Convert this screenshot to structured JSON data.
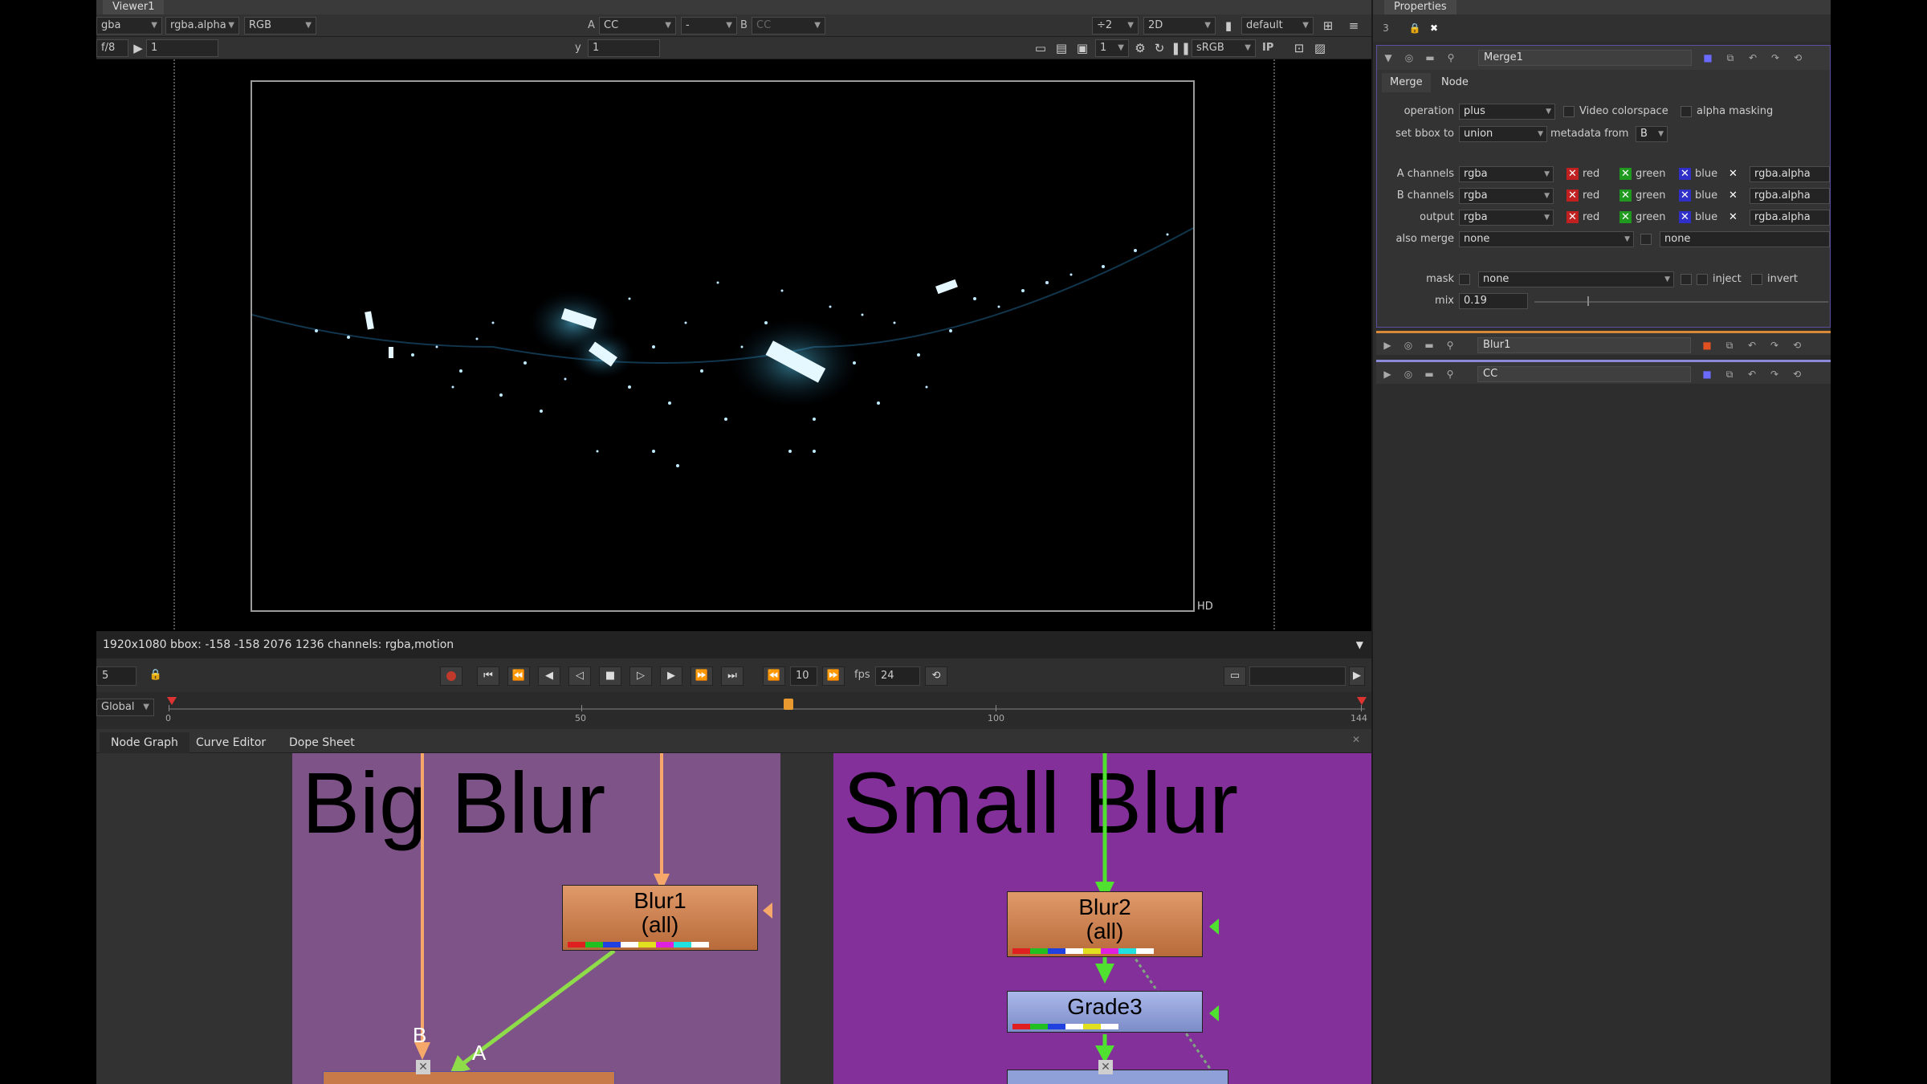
{
  "viewer": {
    "tab": "Viewer1",
    "channels": "gba",
    "alpha_channel": "rgba.alpha",
    "display": "RGB",
    "input_a_label": "A",
    "input_a": "CC",
    "composite": "-",
    "input_b_label": "B",
    "input_b": "CC",
    "proxy": "÷2",
    "view_mode": "2D",
    "lut": "default",
    "fstop_label": "f/8",
    "frame_field": "1",
    "y_label": "y",
    "y_value": "1",
    "zoom": "1",
    "colorspace": "sRGB",
    "ip_label": "IP",
    "hd_label": "HD",
    "info": "1920x1080  bbox: -158 -158 2076 1236  channels: rgba,motion"
  },
  "transport": {
    "frame": "5",
    "step": "10",
    "fps_label": "fps",
    "fps": "24",
    "scope": "Global",
    "ruler_labels": [
      "0",
      "50",
      "100",
      "144"
    ]
  },
  "nodegraph": {
    "tabs": [
      "Node Graph",
      "Curve Editor",
      "Dope Sheet"
    ],
    "backdrops": [
      {
        "title": "Big Blur",
        "color": "#7e5388"
      },
      {
        "title": "Small Blur",
        "color": "#83309a"
      }
    ],
    "nodes": {
      "blur1": {
        "name": "Blur1",
        "sub": "(all)"
      },
      "blur2": {
        "name": "Blur2",
        "sub": "(all)"
      },
      "grade3": {
        "name": "Grade3"
      }
    },
    "input_labels": {
      "b": "B",
      "a": "A"
    }
  },
  "properties": {
    "tab": "Properties",
    "merge": {
      "name": "Merge1",
      "tabs": [
        "Merge",
        "Node"
      ],
      "operation_label": "operation",
      "operation": "plus",
      "video_colorspace": "Video colorspace",
      "alpha_masking": "alpha masking",
      "bbox_label": "set bbox to",
      "bbox": "union",
      "metadata_label": "metadata from",
      "metadata": "B",
      "a_channels_label": "A channels",
      "b_channels_label": "B channels",
      "output_label": "output",
      "rgba": "rgba",
      "red": "red",
      "green": "green",
      "blue": "blue",
      "alpha": "rgba.alpha",
      "also_merge_label": "also merge",
      "also_merge": "none",
      "also_merge_2": "none",
      "mask_label": "mask",
      "mask": "none",
      "inject": "inject",
      "invert": "invert",
      "mix_label": "mix",
      "mix": "0.19"
    },
    "collapsed": [
      {
        "name": "Blur1"
      },
      {
        "name": "CC"
      }
    ]
  },
  "colors": {
    "node_blur": "#c87a48",
    "node_grade": "#8fa0d8",
    "pipe_orange": "#f5a86a",
    "pipe_green": "#50e030"
  }
}
